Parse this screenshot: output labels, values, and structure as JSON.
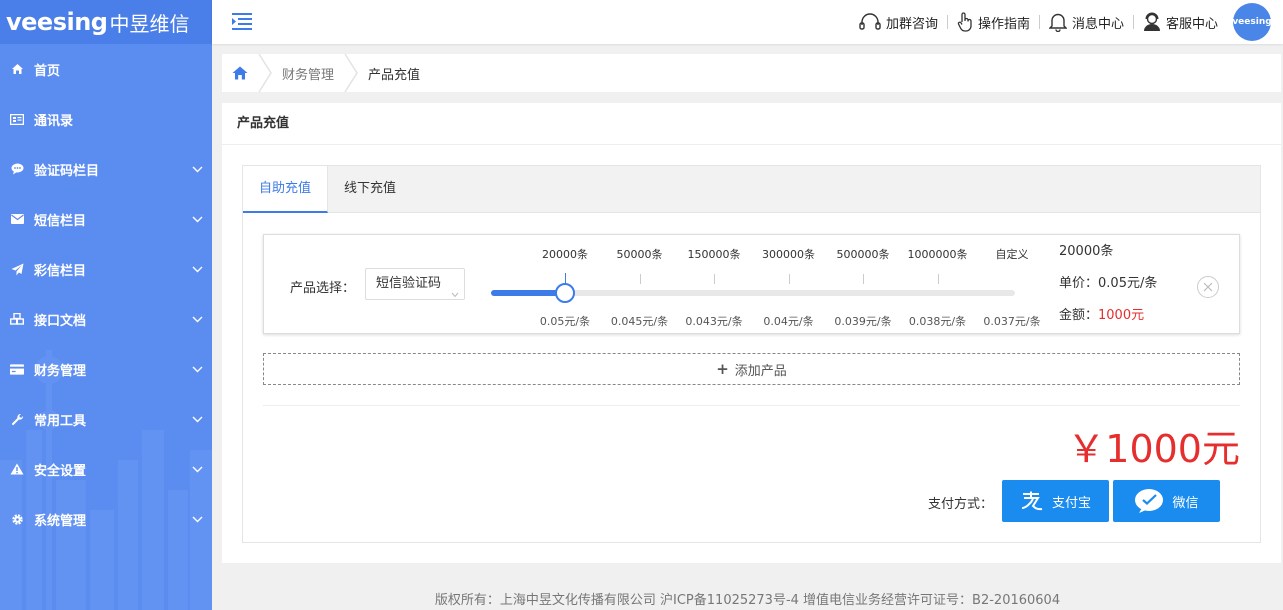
{
  "brand": {
    "logo": "veesing",
    "logo_cn": "中昱维信"
  },
  "sidebar": {
    "items": [
      {
        "label": "首页",
        "icon": "home-icon",
        "has_children": false
      },
      {
        "label": "通讯录",
        "icon": "contacts-icon",
        "has_children": false
      },
      {
        "label": "验证码栏目",
        "icon": "chat-icon",
        "has_children": true
      },
      {
        "label": "短信栏目",
        "icon": "envelope-icon",
        "has_children": true
      },
      {
        "label": "彩信栏目",
        "icon": "send-icon",
        "has_children": true
      },
      {
        "label": "接口文档",
        "icon": "cubes-icon",
        "has_children": true
      },
      {
        "label": "财务管理",
        "icon": "card-icon",
        "has_children": true
      },
      {
        "label": "常用工具",
        "icon": "wrench-icon",
        "has_children": true
      },
      {
        "label": "安全设置",
        "icon": "warning-icon",
        "has_children": true
      },
      {
        "label": "系统管理",
        "icon": "gear-icon",
        "has_children": true
      }
    ]
  },
  "header": {
    "links": [
      {
        "label": "加群咨询",
        "icon": "headset-icon"
      },
      {
        "label": "操作指南",
        "icon": "hand-pointer-icon"
      },
      {
        "label": "消息中心",
        "icon": "bell-icon"
      },
      {
        "label": "客服中心",
        "icon": "agent-icon"
      }
    ],
    "avatar_text": "veesing"
  },
  "breadcrumb": {
    "items": [
      "财务管理",
      "产品充值"
    ]
  },
  "page": {
    "title": "产品充值"
  },
  "tabs": [
    {
      "label": "自助充值",
      "active": true
    },
    {
      "label": "线下充值",
      "active": false
    }
  ],
  "product": {
    "select_label": "产品选择：",
    "selected": "短信验证码",
    "tiers": [
      {
        "qty": "20000条",
        "price": "0.05元/条"
      },
      {
        "qty": "50000条",
        "price": "0.045元/条"
      },
      {
        "qty": "150000条",
        "price": "0.043元/条"
      },
      {
        "qty": "300000条",
        "price": "0.04元/条"
      },
      {
        "qty": "500000条",
        "price": "0.039元/条"
      },
      {
        "qty": "1000000条",
        "price": "0.038元/条"
      },
      {
        "qty": "自定义",
        "price": "0.037元/条"
      }
    ],
    "selected_tier_index": 0,
    "slider_fraction": 0.142,
    "summary_qty": "20000条",
    "unit_price_label": "单价：",
    "unit_price": "0.05元/条",
    "amount_label": "金额：",
    "amount": "1000元"
  },
  "add_product_label": "添加产品",
  "total": "￥1000元",
  "payment": {
    "label": "支付方式：",
    "alipay": "支付宝",
    "wechat": "微信"
  },
  "footer": "版权所有：上海中昱文化传播有限公司 沪ICP备11025273号-4 增值电信业务经营许可证号：B2-20160604",
  "colors": {
    "sidebar": "#5b8cf0",
    "accent": "#3d7be9",
    "price": "#e62e2e",
    "pay_button": "#1a8cf0"
  }
}
